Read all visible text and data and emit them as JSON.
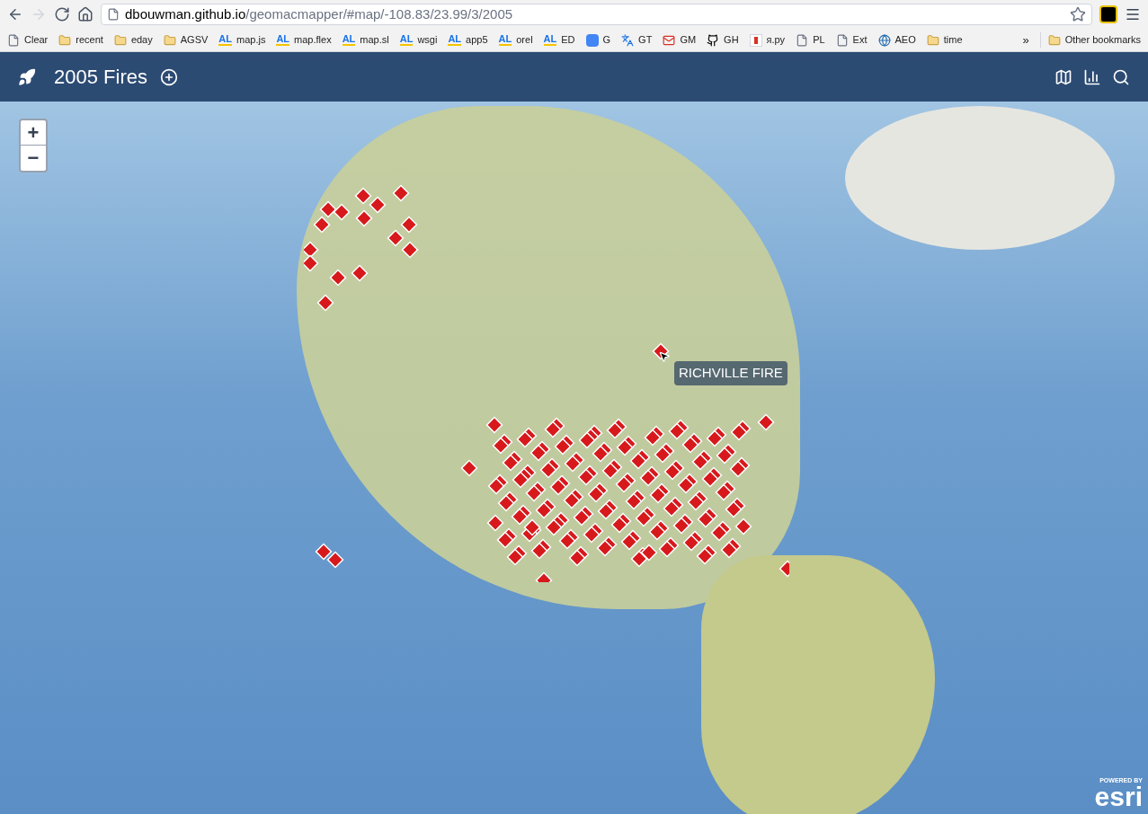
{
  "browser": {
    "url_host": "dbouwman.github.io",
    "url_path": "/geomacmapper/#map/-108.83/23.99/3/2005",
    "bookmarks": [
      {
        "kind": "page",
        "label": "Clear"
      },
      {
        "kind": "folder",
        "label": "recent"
      },
      {
        "kind": "folder",
        "label": "eday"
      },
      {
        "kind": "folder",
        "label": "AGSV"
      },
      {
        "kind": "al",
        "icon_text": "AL",
        "label": "map.js"
      },
      {
        "kind": "al",
        "icon_text": "AL",
        "label": "map.flex"
      },
      {
        "kind": "al",
        "icon_text": "AL",
        "label": "map.sl"
      },
      {
        "kind": "al",
        "icon_text": "AL",
        "label": "wsgi"
      },
      {
        "kind": "al",
        "icon_text": "AL",
        "label": "app5"
      },
      {
        "kind": "al",
        "icon_text": "AL",
        "label": "orel"
      },
      {
        "kind": "al",
        "icon_text": "AL",
        "label": "ED"
      },
      {
        "kind": "google",
        "label": "G"
      },
      {
        "kind": "translate",
        "label": "GT"
      },
      {
        "kind": "mail",
        "label": "GM"
      },
      {
        "kind": "github",
        "label": "GH"
      },
      {
        "kind": "ya",
        "label": "я.ру"
      },
      {
        "kind": "page",
        "label": "PL"
      },
      {
        "kind": "page",
        "label": "Ext"
      },
      {
        "kind": "globe",
        "label": "AEO"
      },
      {
        "kind": "folder",
        "label": "time"
      }
    ],
    "more": "»",
    "other_bookmarks": "Other bookmarks"
  },
  "app": {
    "title": "2005 Fires",
    "tools": [
      {
        "kind": "map"
      },
      {
        "kind": "chart"
      },
      {
        "kind": "search"
      }
    ]
  },
  "map": {
    "zoom_in": "+",
    "zoom_out": "−",
    "tooltip": "RICHVILLE FIRE",
    "attribution_top": "POWERED BY",
    "attribution_logo": "esri"
  }
}
